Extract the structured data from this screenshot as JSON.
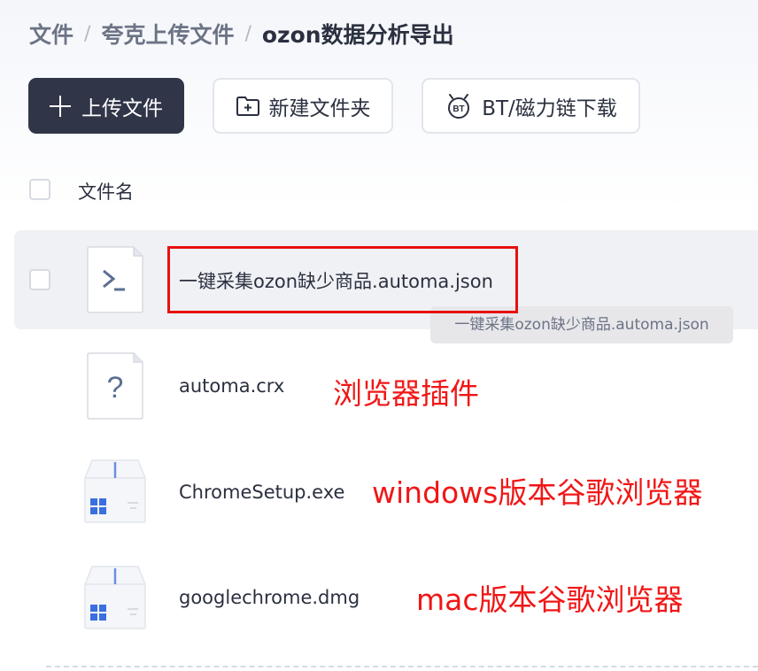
{
  "breadcrumb": {
    "items": [
      "文件",
      "夸克上传文件"
    ],
    "current": "ozon数据分析导出",
    "separator": "/"
  },
  "toolbar": {
    "upload_label": "上传文件",
    "new_folder_label": "新建文件夹",
    "bt_label": "BT/磁力链下载",
    "bt_icon_text": "BT"
  },
  "list": {
    "header_label": "文件名",
    "files": [
      {
        "name": "一键采集ozon缺少商品.automa.json",
        "icon": "code-file-icon"
      },
      {
        "name": "automa.crx",
        "icon": "unknown-file-icon",
        "icon_glyph": "?"
      },
      {
        "name": "ChromeSetup.exe",
        "icon": "windows-app-icon"
      },
      {
        "name": "googlechrome.dmg",
        "icon": "windows-app-icon"
      }
    ]
  },
  "tooltip": "一键采集ozon缺少商品.automa.json",
  "annotations": {
    "crx_note": "浏览器插件",
    "exe_note": "windows版本谷歌浏览器",
    "dmg_note": "mac版本谷歌浏览器"
  },
  "colors": {
    "primary_button": "#313548",
    "annotation_red": "#f01616",
    "row_hover": "#f0f1f4"
  }
}
